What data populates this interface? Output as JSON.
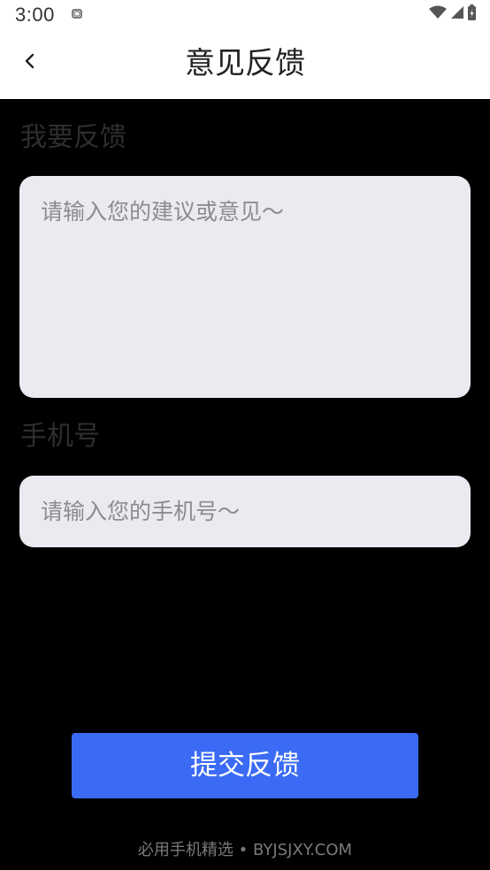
{
  "status_bar": {
    "time": "3:00",
    "icons": [
      "notification-icon",
      "wifi-icon",
      "cell-signal-icon",
      "battery-icon"
    ]
  },
  "header": {
    "back_icon": "chevron-left-icon",
    "title": "意见反馈"
  },
  "feedback_section": {
    "label": "我要反馈",
    "placeholder": "请输入您的建议或意见～"
  },
  "phone_section": {
    "label": "手机号",
    "placeholder": "请输入您的手机号～"
  },
  "submit": {
    "label": "提交反馈"
  },
  "watermark": {
    "text": "必用手机精选 • BYJSJXY.COM"
  },
  "colors": {
    "accent": "#3b6bf5",
    "page_background": "#000000",
    "input_background": "#eaebf0",
    "header_background": "#ffffff"
  }
}
